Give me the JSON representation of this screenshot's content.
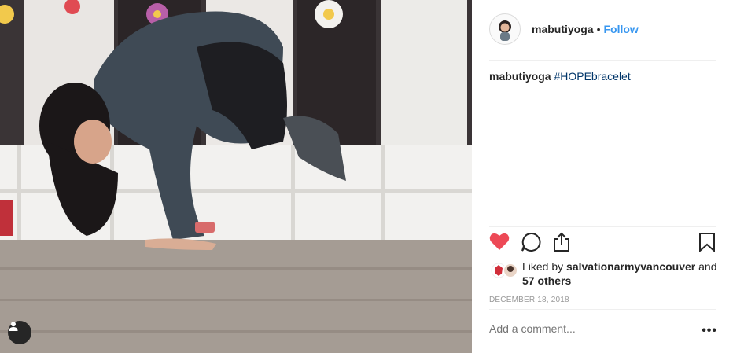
{
  "post": {
    "username": "mabutiyoga",
    "follow_label": "Follow",
    "separator": "•",
    "caption_user": "mabutiyoga",
    "caption_hashtag": "#HOPEbracelet",
    "liked_prefix": "Liked by",
    "liked_by_user": "salvationarmyvancouver",
    "liked_and": "and",
    "likes_others": "57 others",
    "date": "DECEMBER 18, 2018",
    "comment_placeholder": "Add a comment...",
    "more_options": "•••"
  },
  "colors": {
    "heart": "#ed4956",
    "link": "#3897f0",
    "hashtag": "#003569"
  },
  "icons": [
    "user-tag-icon",
    "heart-icon",
    "comment-icon",
    "share-icon",
    "bookmark-icon",
    "more-icon"
  ]
}
